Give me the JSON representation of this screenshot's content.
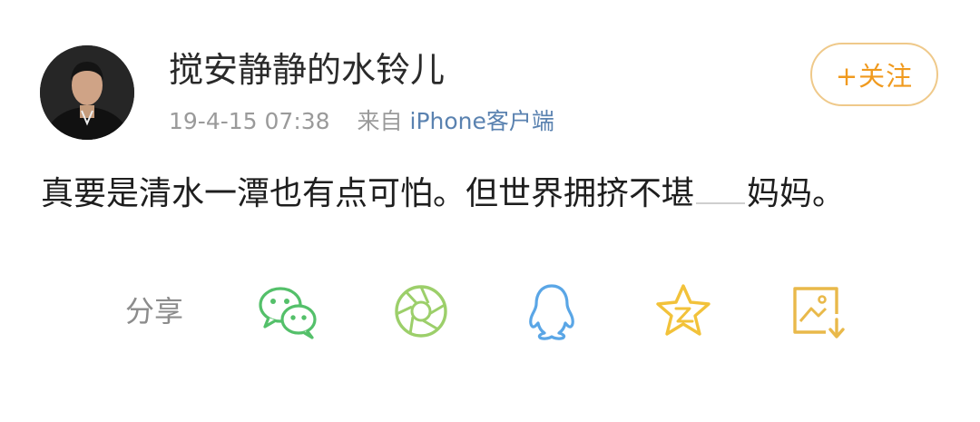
{
  "post": {
    "author": "搅安静静的水铃儿",
    "timestamp": "19-4-15 07:38",
    "source_prefix": "来自",
    "source_client": "iPhone客户端",
    "follow_label": "+关注",
    "body_part1": "真要是清水一潭也有点可怕。但世界拥挤不堪",
    "body_part2": "妈妈。"
  },
  "share": {
    "label": "分享",
    "icons": [
      "wechat-icon",
      "moments-icon",
      "qq-icon",
      "qzone-star-icon",
      "save-image-icon"
    ]
  },
  "colors": {
    "accent_orange": "#f09a1e",
    "wechat_green": "#54c06a",
    "moments_green": "#9ccf6a",
    "qq_blue": "#5aa6e6",
    "star_yellow": "#f2c23a",
    "save_yellow": "#e9b94a",
    "link_blue": "#5a82b0"
  }
}
